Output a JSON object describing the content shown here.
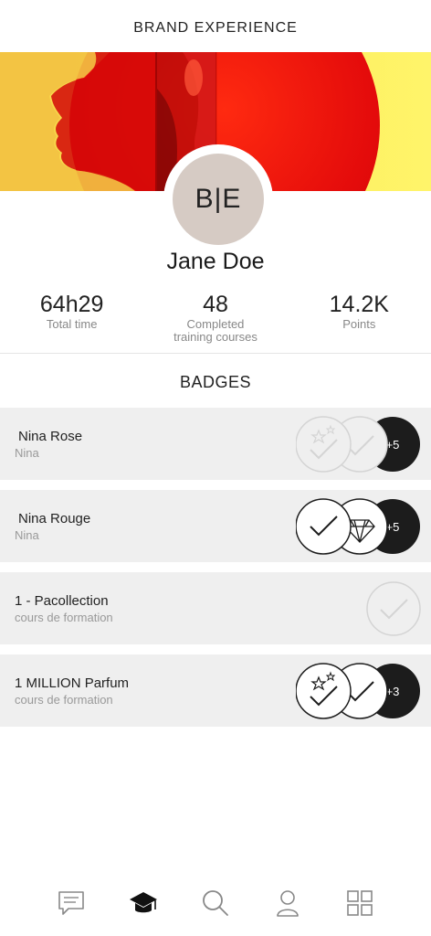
{
  "header": {
    "title": "BRAND EXPERIENCE"
  },
  "profile": {
    "initials": "B|E",
    "name": "Jane Doe"
  },
  "stats": [
    {
      "value": "64h29",
      "label": "Total time"
    },
    {
      "value": "48",
      "label": "Completed training courses"
    },
    {
      "value": "14.2K",
      "label": "Points"
    }
  ],
  "badges": {
    "title": "BADGES",
    "items": [
      {
        "name": "Nina Rose",
        "subtitle": "Nina",
        "icons": [
          "stars-check-badge-icon-faded",
          "check-badge-icon-faded"
        ],
        "more": "+5"
      },
      {
        "name": "Nina Rouge",
        "subtitle": "Nina",
        "icons": [
          "check-badge-icon",
          "diamond-badge-icon"
        ],
        "more": "+5"
      },
      {
        "name": "1 - Pacollection",
        "subtitle": "cours de formation",
        "icons": [
          "check-badge-icon-faded"
        ],
        "more": ""
      },
      {
        "name": "1 MILLION Parfum",
        "subtitle": "cours de formation",
        "icons": [
          "stars-check-badge-icon",
          "check-badge-icon"
        ],
        "more": "+3"
      }
    ]
  },
  "nav": [
    "chat-icon",
    "graduation-cap-icon",
    "search-icon",
    "user-icon",
    "grid-icon"
  ],
  "colors": {
    "hero_red": "#e01010",
    "hero_yellow": "#f8e15a",
    "avatar_bg": "#d6cbc4",
    "row_bg": "#efefef",
    "more_badge": "#1c1c1c"
  }
}
